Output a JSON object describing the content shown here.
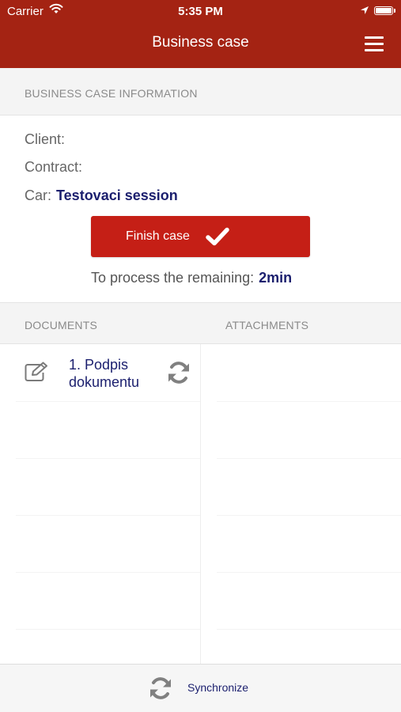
{
  "status_bar": {
    "carrier": "Carrier",
    "time": "5:35 PM"
  },
  "nav": {
    "title": "Business case",
    "menu_icon": "hamburger-menu-icon"
  },
  "info_section": {
    "header": "BUSINESS CASE INFORMATION",
    "client_label": "Client:",
    "client_value": "",
    "contract_label": "Contract:",
    "contract_value": "",
    "car_label": "Car:",
    "car_value": "Testovaci session"
  },
  "finish_button": {
    "label": "Finish case",
    "icon": "checkmark-icon"
  },
  "remaining": {
    "label": "To process the remaining:",
    "value": "2min"
  },
  "tabs": {
    "documents": "DOCUMENTS",
    "attachments": "ATTACHMENTS"
  },
  "documents": [
    {
      "title": "1. Podpis dokumentu",
      "icon": "edit-icon",
      "action_icon": "sync-icon"
    }
  ],
  "bottom_bar": {
    "label": "Synchronize",
    "icon": "sync-icon"
  },
  "colors": {
    "brand_red": "#a42313",
    "button_red": "#c51f16",
    "accent_navy": "#1b1f6e"
  }
}
